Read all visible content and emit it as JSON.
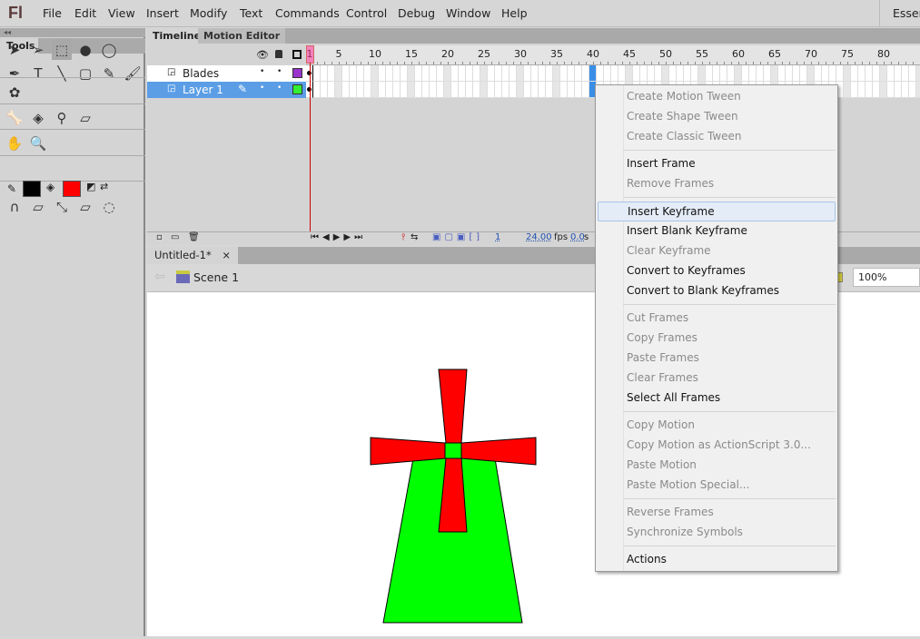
{
  "app": {
    "logo": "Fl",
    "menus": [
      "File",
      "Edit",
      "View",
      "Insert",
      "Modify",
      "Text",
      "Commands",
      "Control",
      "Debug",
      "Window",
      "Help"
    ],
    "workspace": "Essentials"
  },
  "tools": {
    "collapse": "◂◂",
    "title": "Tools",
    "stroke_color": "#000000",
    "fill_color": "#ff0000"
  },
  "timeline": {
    "tabs": [
      "Timeline",
      "Motion Editor"
    ],
    "ruler": [
      "1",
      "5",
      "10",
      "15",
      "20",
      "25",
      "30",
      "35",
      "40",
      "45",
      "50",
      "55",
      "60",
      "65",
      "70",
      "75",
      "80"
    ],
    "layers": [
      {
        "name": "Blades",
        "color": "#9933cc",
        "selected": false
      },
      {
        "name": "Layer 1",
        "color": "#33ee33",
        "selected": true
      }
    ],
    "current_frame": "1",
    "fps": "24.00",
    "fps_unit": "fps",
    "time": "0.0",
    "time_unit": "s",
    "selected_frame": "40"
  },
  "document": {
    "tab": "Untitled-1*",
    "close": "×",
    "scene": "Scene 1",
    "zoom": "100%"
  },
  "context_menu": [
    [
      {
        "label": "Create Motion Tween",
        "enabled": false
      },
      {
        "label": "Create Shape Tween",
        "enabled": false
      },
      {
        "label": "Create Classic Tween",
        "enabled": false
      }
    ],
    [
      {
        "label": "Insert Frame",
        "enabled": true
      },
      {
        "label": "Remove Frames",
        "enabled": false
      }
    ],
    [
      {
        "label": "Insert Keyframe",
        "enabled": true,
        "highlighted": true
      },
      {
        "label": "Insert Blank Keyframe",
        "enabled": true
      },
      {
        "label": "Clear Keyframe",
        "enabled": false
      },
      {
        "label": "Convert to Keyframes",
        "enabled": true
      },
      {
        "label": "Convert to Blank Keyframes",
        "enabled": true
      }
    ],
    [
      {
        "label": "Cut Frames",
        "enabled": false
      },
      {
        "label": "Copy Frames",
        "enabled": false
      },
      {
        "label": "Paste Frames",
        "enabled": false
      },
      {
        "label": "Clear Frames",
        "enabled": false
      },
      {
        "label": "Select All Frames",
        "enabled": true
      }
    ],
    [
      {
        "label": "Copy Motion",
        "enabled": false
      },
      {
        "label": "Copy Motion as ActionScript 3.0...",
        "enabled": false
      },
      {
        "label": "Paste Motion",
        "enabled": false
      },
      {
        "label": "Paste Motion Special...",
        "enabled": false
      }
    ],
    [
      {
        "label": "Reverse Frames",
        "enabled": false
      },
      {
        "label": "Synchronize Symbols",
        "enabled": false
      }
    ],
    [
      {
        "label": "Actions",
        "enabled": true
      }
    ]
  ],
  "colors": {
    "tower": "#00ff00",
    "blades": "#ff0000",
    "selection": "#5b9ee6"
  }
}
